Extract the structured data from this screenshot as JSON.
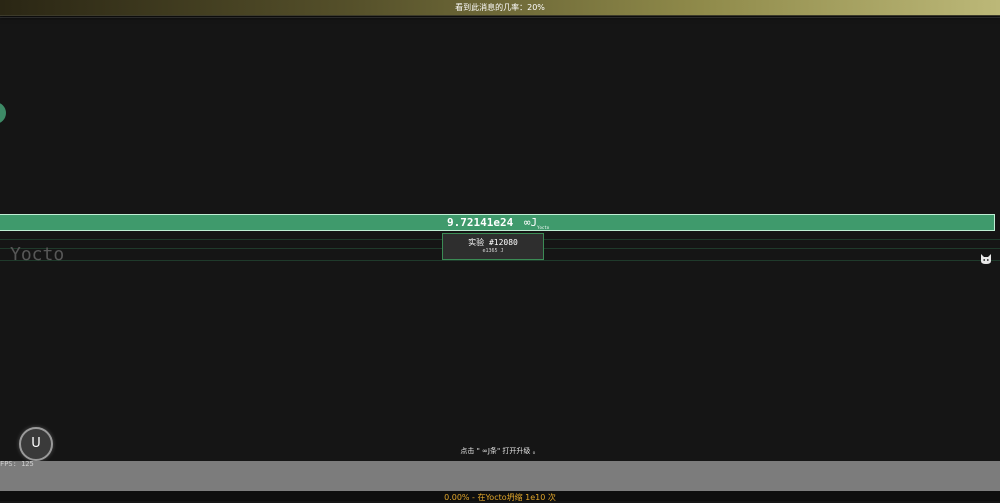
{
  "banner": {
    "text": "看到此消息的几率：20%"
  },
  "energy": {
    "value": "9.72141e24",
    "unit": "∞J",
    "unit_sub": "Yocto"
  },
  "row": {
    "label": "Yocto"
  },
  "research_card": {
    "title": "实验 #12080",
    "cost": "e1365 J"
  },
  "hint": {
    "text": "点击 \" ∞J条\" 打开升级 。"
  },
  "upgrade_button": {
    "label": "U"
  },
  "fps": {
    "text": "FPS: 125"
  },
  "status": {
    "text": "0.00% - 在Yocto坍缩 1e10 次"
  },
  "colors": {
    "bar_green": "#3f9a6c",
    "status_orange": "#e0a52a",
    "background": "#151515"
  },
  "icons": {
    "right_icon": "cat-icon"
  }
}
